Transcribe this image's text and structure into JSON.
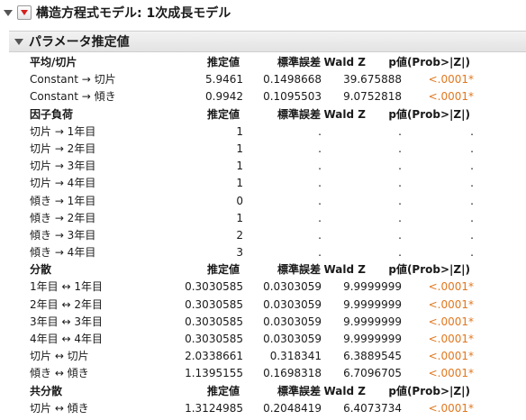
{
  "outline": {
    "title": "構造方程式モデル: 1次成長モデル"
  },
  "report": {
    "title": "パラメータ推定値"
  },
  "sections": [
    {
      "header": [
        "平均/切片",
        "推定値",
        "標準誤差",
        "Wald Z",
        "p値(Prob>|Z|)"
      ],
      "rows": [
        [
          "Constant → 切片",
          "5.9461",
          "0.1498668",
          "39.675888",
          "<.0001*"
        ],
        [
          "Constant → 傾き",
          "0.9942",
          "0.1095503",
          "9.0752818",
          "<.0001*"
        ]
      ]
    },
    {
      "header": [
        "因子負荷",
        "推定値",
        "標準誤差",
        "Wald Z",
        "p値(Prob>|Z|)"
      ],
      "rows": [
        [
          "切片 → 1年目",
          "1",
          ".",
          ".",
          "."
        ],
        [
          "切片 → 2年目",
          "1",
          ".",
          ".",
          "."
        ],
        [
          "切片 → 3年目",
          "1",
          ".",
          ".",
          "."
        ],
        [
          "切片 → 4年目",
          "1",
          ".",
          ".",
          "."
        ],
        [
          "傾き → 1年目",
          "0",
          ".",
          ".",
          "."
        ],
        [
          "傾き → 2年目",
          "1",
          ".",
          ".",
          "."
        ],
        [
          "傾き → 3年目",
          "2",
          ".",
          ".",
          "."
        ],
        [
          "傾き → 4年目",
          "3",
          ".",
          ".",
          "."
        ]
      ]
    },
    {
      "header": [
        "分散",
        "推定値",
        "標準誤差",
        "Wald Z",
        "p値(Prob>|Z|)"
      ],
      "rows": [
        [
          "1年目 ↔ 1年目",
          "0.3030585",
          "0.0303059",
          "9.9999999",
          "<.0001*"
        ],
        [
          "2年目 ↔ 2年目",
          "0.3030585",
          "0.0303059",
          "9.9999999",
          "<.0001*"
        ],
        [
          "3年目 ↔ 3年目",
          "0.3030585",
          "0.0303059",
          "9.9999999",
          "<.0001*"
        ],
        [
          "4年目 ↔ 4年目",
          "0.3030585",
          "0.0303059",
          "9.9999999",
          "<.0001*"
        ],
        [
          "切片 ↔ 切片",
          "2.0338661",
          "0.318341",
          "6.3889545",
          "<.0001*"
        ],
        [
          "傾き ↔ 傾き",
          "1.1395155",
          "0.1698318",
          "6.7096705",
          "<.0001*"
        ]
      ]
    },
    {
      "header": [
        "共分散",
        "推定値",
        "標準誤差",
        "Wald Z",
        "p値(Prob>|Z|)"
      ],
      "rows": [
        [
          "切片 ↔ 傾き",
          "1.3124985",
          "0.2048419",
          "6.4073734",
          "<.0001*"
        ]
      ]
    }
  ],
  "colors": {
    "pvalue": "#e07820",
    "menu_triangle": "#d4201c"
  }
}
